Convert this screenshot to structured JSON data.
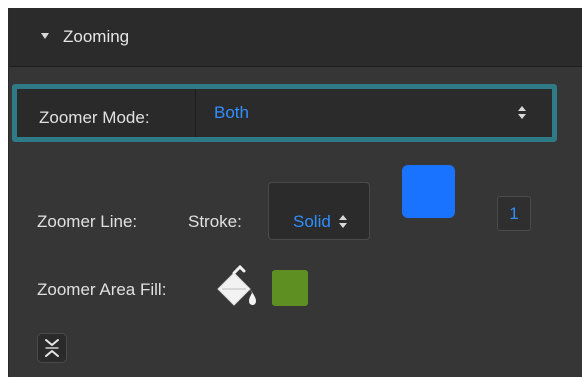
{
  "section": {
    "title": "Zooming"
  },
  "zoomer_mode": {
    "label": "Zoomer Mode:",
    "value": "Both"
  },
  "zoomer_line": {
    "label": "Zoomer Line:",
    "stroke_label": "Stroke:",
    "stroke_value": "Solid",
    "color": "#1a73ff",
    "width": "1"
  },
  "zoomer_area_fill": {
    "label": "Zoomer Area Fill:",
    "color": "#5d8f22"
  },
  "colors": {
    "panel_bg": "#363636",
    "header_bg": "#2b2b2b",
    "focus_ring": "#2f7a87",
    "value_text": "#2f8fff"
  }
}
